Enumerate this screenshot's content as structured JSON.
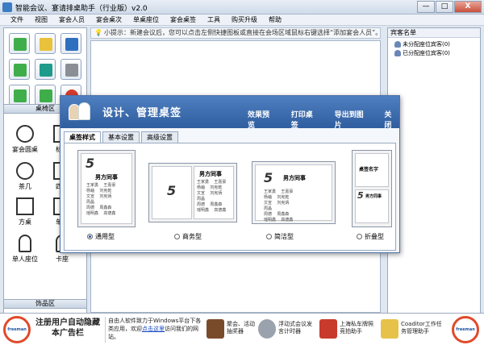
{
  "window": {
    "title": "智能会议、宴请排桌助手（行业版）v2.0",
    "min": "—",
    "max": "□",
    "close": "X"
  },
  "menu": [
    "文件",
    "视图",
    "宴会人员",
    "宴会桌次",
    "单桌座位",
    "宴会桌签",
    "工具",
    "购买升级",
    "帮助"
  ],
  "hint": {
    "text": "小提示：新建会议后，您可以点击左侧快捷图板或直接在会场区域鼠标右键选择“添加宴会人员”。"
  },
  "left_panel": {
    "table_section": "桌椅区",
    "furniture": [
      {
        "label": "宴会圆桌"
      },
      {
        "label": "标准"
      },
      {
        "label": "茶几"
      },
      {
        "label": "四人"
      },
      {
        "label": "方桌"
      },
      {
        "label": "单人"
      },
      {
        "label": "单人座位"
      },
      {
        "label": "卡座"
      }
    ],
    "decor_section": "饰品区"
  },
  "right_panel": {
    "title": "宾客名单",
    "items": [
      "未分配座位宾客(0)",
      "已分配座位宾客(0)"
    ]
  },
  "dialog": {
    "title": "设计、管理桌签",
    "actions": [
      "效果预览",
      "打印桌签",
      "导出到图片",
      "关 闭"
    ],
    "tabs": [
      "桌签样式",
      "基本设置",
      "高级设置"
    ],
    "styles": [
      {
        "label": "通用型",
        "selected": true
      },
      {
        "label": "商务型",
        "selected": false
      },
      {
        "label": "简洁型",
        "selected": false
      },
      {
        "label": "折叠型",
        "selected": false
      }
    ],
    "card": {
      "number": "5",
      "name": "男方同事",
      "guests": "王家勇    王嘉豪\n杨岫    刘宪乾\n文宣    刘宪炳\n周晶\n周德    周鑫森\n瑶明鑫    高德鑫",
      "folded_name": "桌签名字"
    }
  },
  "ads": {
    "logo": "freeman",
    "main": "注册用户自动隐藏本广告栏",
    "text_before": "自由人软件致力于Windows平台下各类应用，欢迎",
    "link": "点击这里",
    "text_after": "访问我们的网站。",
    "items": [
      "聚会、活动抽奖器",
      "浮动式会议发言计时器",
      "上海私车牌照竞拍助手",
      "Coaditor工作任务管理助手"
    ]
  }
}
